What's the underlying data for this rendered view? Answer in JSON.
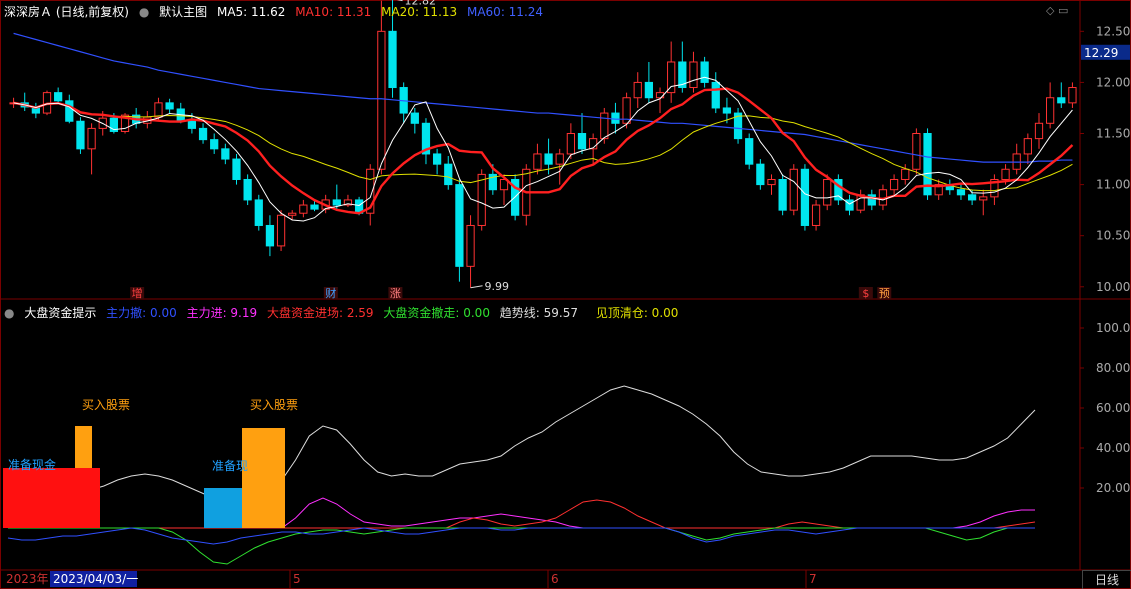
{
  "header": {
    "stock_name": "深深房Ａ (日线,前复权)",
    "main_chart_label": "默认主图",
    "ma5": "MA5: 11.62",
    "ma10": "MA10: 11.31",
    "ma20": "MA20: 11.13",
    "ma60": "MA60: 11.24"
  },
  "sub_header": {
    "indicator_name": "大盘资金提示",
    "main_out": "主力撤: 0.00",
    "main_in": "主力进: 9.19",
    "market_in": "大盘资金进场: 2.59",
    "market_out": "大盘资金撤走: 0.00",
    "trend": "趋势线: 59.57",
    "top_clear": "见顶清仓: 0.00"
  },
  "colors": {
    "up": "#ff3232",
    "down": "#00e5ee",
    "ma5": "#ffffff",
    "ma10": "#ff2020",
    "ma20": "#e0e000",
    "ma60": "#3050ff",
    "grid": "#7a0000",
    "ma10_text": "#ff3030",
    "ma20_text": "#e0e000",
    "ma60_text": "#4060ff",
    "price_tag_bg": "#0a2a8a"
  },
  "price_axis": {
    "ticks": [
      "12.50",
      "12.00",
      "11.50",
      "11.00",
      "10.50",
      "10.00"
    ],
    "current": "12.29"
  },
  "indicator_axis": {
    "ticks": [
      "100.00",
      "80.00",
      "60.00",
      "40.00",
      "20.00"
    ]
  },
  "annotations": {
    "high": "12.82",
    "low": "9.99"
  },
  "event_markers": [
    {
      "label": "增",
      "color": "#ff4040"
    },
    {
      "label": "财",
      "color": "#40a0ff"
    },
    {
      "label": "涨",
      "color": "#ff8080"
    },
    {
      "label": "$",
      "color": "#ff4040"
    },
    {
      "label": "预",
      "color": "#ffa040"
    }
  ],
  "signals": {
    "buy_label": "买入股票",
    "prepare_cash": "准备现金",
    "prepare_partial": "准备现"
  },
  "bottom_axis": {
    "year_label": "2023年",
    "cursor_date": "2023/04/03/一",
    "months": [
      "5",
      "6",
      "7"
    ]
  },
  "period_button": "日线",
  "chart_data": [
    {
      "type": "candlestick",
      "title": "深深房Ａ (日线,前复权)",
      "ylim": [
        9.9,
        12.65
      ],
      "x_month_labels": [
        "5",
        "6",
        "7"
      ],
      "ohlc": [
        [
          11.8,
          11.85,
          11.75,
          11.8
        ],
        [
          11.8,
          11.9,
          11.72,
          11.76
        ],
        [
          11.76,
          11.8,
          11.65,
          11.7
        ],
        [
          11.7,
          11.92,
          11.68,
          11.9
        ],
        [
          11.9,
          11.95,
          11.8,
          11.82
        ],
        [
          11.82,
          11.88,
          11.6,
          11.62
        ],
        [
          11.62,
          11.66,
          11.3,
          11.35
        ],
        [
          11.35,
          11.6,
          11.1,
          11.55
        ],
        [
          11.55,
          11.72,
          11.48,
          11.65
        ],
        [
          11.65,
          11.7,
          11.5,
          11.52
        ],
        [
          11.52,
          11.7,
          11.5,
          11.68
        ],
        [
          11.68,
          11.75,
          11.55,
          11.6
        ],
        [
          11.6,
          11.72,
          11.55,
          11.66
        ],
        [
          11.66,
          11.85,
          11.62,
          11.8
        ],
        [
          11.8,
          11.84,
          11.7,
          11.74
        ],
        [
          11.74,
          11.8,
          11.6,
          11.62
        ],
        [
          11.62,
          11.7,
          11.5,
          11.55
        ],
        [
          11.55,
          11.6,
          11.4,
          11.44
        ],
        [
          11.44,
          11.5,
          11.3,
          11.35
        ],
        [
          11.35,
          11.4,
          11.2,
          11.25
        ],
        [
          11.25,
          11.3,
          11.0,
          11.05
        ],
        [
          11.05,
          11.1,
          10.8,
          10.85
        ],
        [
          10.85,
          10.9,
          10.55,
          10.6
        ],
        [
          10.6,
          10.7,
          10.3,
          10.4
        ],
        [
          10.4,
          10.75,
          10.35,
          10.7
        ],
        [
          10.7,
          10.75,
          10.65,
          10.72
        ],
        [
          10.72,
          10.85,
          10.68,
          10.8
        ],
        [
          10.8,
          10.85,
          10.74,
          10.76
        ],
        [
          10.76,
          10.9,
          10.72,
          10.85
        ],
        [
          10.85,
          11.0,
          10.75,
          10.8
        ],
        [
          10.8,
          10.9,
          10.78,
          10.85
        ],
        [
          10.85,
          10.88,
          10.7,
          10.72
        ],
        [
          10.72,
          11.2,
          10.6,
          11.15
        ],
        [
          11.15,
          12.8,
          11.1,
          12.5
        ],
        [
          12.5,
          12.82,
          11.85,
          11.95
        ],
        [
          11.95,
          12.0,
          11.6,
          11.7
        ],
        [
          11.7,
          11.75,
          11.5,
          11.6
        ],
        [
          11.6,
          11.65,
          11.2,
          11.3
        ],
        [
          11.3,
          11.35,
          11.1,
          11.2
        ],
        [
          11.2,
          11.28,
          10.95,
          11.0
        ],
        [
          11.0,
          11.05,
          10.05,
          10.2
        ],
        [
          10.2,
          10.7,
          9.99,
          10.6
        ],
        [
          10.6,
          11.15,
          10.55,
          11.1
        ],
        [
          11.1,
          11.2,
          10.9,
          10.95
        ],
        [
          10.95,
          11.1,
          10.8,
          11.05
        ],
        [
          11.05,
          11.1,
          10.65,
          10.7
        ],
        [
          10.7,
          11.2,
          10.6,
          11.15
        ],
        [
          11.15,
          11.4,
          11.1,
          11.3
        ],
        [
          11.3,
          11.45,
          11.1,
          11.2
        ],
        [
          11.2,
          11.35,
          11.0,
          11.3
        ],
        [
          11.3,
          11.6,
          11.25,
          11.5
        ],
        [
          11.5,
          11.7,
          11.3,
          11.35
        ],
        [
          11.35,
          11.5,
          11.2,
          11.45
        ],
        [
          11.45,
          11.75,
          11.4,
          11.7
        ],
        [
          11.7,
          11.8,
          11.5,
          11.6
        ],
        [
          11.6,
          11.9,
          11.55,
          11.85
        ],
        [
          11.85,
          12.1,
          11.75,
          12.0
        ],
        [
          12.0,
          12.2,
          11.8,
          11.85
        ],
        [
          11.85,
          11.95,
          11.7,
          11.9
        ],
        [
          11.9,
          12.4,
          11.8,
          12.2
        ],
        [
          12.2,
          12.4,
          11.9,
          11.95
        ],
        [
          11.95,
          12.3,
          11.9,
          12.2
        ],
        [
          12.2,
          12.25,
          11.95,
          12.0
        ],
        [
          12.0,
          12.1,
          11.7,
          11.75
        ],
        [
          11.75,
          11.85,
          11.6,
          11.7
        ],
        [
          11.7,
          11.75,
          11.4,
          11.45
        ],
        [
          11.45,
          11.5,
          11.15,
          11.2
        ],
        [
          11.2,
          11.25,
          10.95,
          11.0
        ],
        [
          11.0,
          11.1,
          10.9,
          11.05
        ],
        [
          11.05,
          11.1,
          10.7,
          10.75
        ],
        [
          10.75,
          11.2,
          10.7,
          11.15
        ],
        [
          11.15,
          11.2,
          10.55,
          10.6
        ],
        [
          10.6,
          10.85,
          10.55,
          10.8
        ],
        [
          10.8,
          11.1,
          10.75,
          11.05
        ],
        [
          11.05,
          11.1,
          10.8,
          10.85
        ],
        [
          10.85,
          10.9,
          10.7,
          10.75
        ],
        [
          10.75,
          10.95,
          10.72,
          10.9
        ],
        [
          10.9,
          10.95,
          10.75,
          10.8
        ],
        [
          10.8,
          11.0,
          10.75,
          10.95
        ],
        [
          10.95,
          11.1,
          10.9,
          11.05
        ],
        [
          11.05,
          11.2,
          11.0,
          11.15
        ],
        [
          11.15,
          11.55,
          11.1,
          11.5
        ],
        [
          11.5,
          11.55,
          10.85,
          10.9
        ],
        [
          10.9,
          11.05,
          10.85,
          11.0
        ],
        [
          11.0,
          11.05,
          10.9,
          10.95
        ],
        [
          10.95,
          11.0,
          10.85,
          10.9
        ],
        [
          10.9,
          10.95,
          10.8,
          10.85
        ],
        [
          10.85,
          10.95,
          10.7,
          10.88
        ],
        [
          10.88,
          11.1,
          10.8,
          11.05
        ],
        [
          11.05,
          11.2,
          11.0,
          11.15
        ],
        [
          11.15,
          11.4,
          11.1,
          11.3
        ],
        [
          11.3,
          11.5,
          11.2,
          11.45
        ],
        [
          11.45,
          11.7,
          11.35,
          11.6
        ],
        [
          11.6,
          12.0,
          11.55,
          11.85
        ],
        [
          11.85,
          12.0,
          11.75,
          11.8
        ],
        [
          11.8,
          12.0,
          11.75,
          11.95
        ]
      ],
      "ma60": [
        12.48,
        12.45,
        12.42,
        12.39,
        12.36,
        12.33,
        12.3,
        12.27,
        12.24,
        12.21,
        12.19,
        12.17,
        12.15,
        12.12,
        12.1,
        12.08,
        12.06,
        12.04,
        12.02,
        12.0,
        11.98,
        11.96,
        11.94,
        11.93,
        11.92,
        11.91,
        11.9,
        11.89,
        11.88,
        11.87,
        11.86,
        11.85,
        11.84,
        11.84,
        11.83,
        11.82,
        11.81,
        11.8,
        11.79,
        11.78,
        11.77,
        11.76,
        11.75,
        11.74,
        11.73,
        11.72,
        11.71,
        11.7,
        11.7,
        11.69,
        11.68,
        11.67,
        11.66,
        11.65,
        11.64,
        11.64,
        11.63,
        11.62,
        11.61,
        11.6,
        11.6,
        11.59,
        11.58,
        11.57,
        11.56,
        11.55,
        11.54,
        11.53,
        11.52,
        11.51,
        11.5,
        11.49,
        11.47,
        11.45,
        11.43,
        11.41,
        11.39,
        11.37,
        11.35,
        11.33,
        11.31,
        11.29,
        11.27,
        11.26,
        11.25,
        11.24,
        11.23,
        11.22,
        11.22,
        11.22,
        11.22,
        11.22,
        11.23,
        11.23,
        11.24,
        11.24
      ]
    },
    {
      "type": "line",
      "title": "大盘资金提示",
      "ylim": [
        -20,
        105
      ],
      "series": [
        {
          "name": "趋势线",
          "values": [
            24,
            22,
            20,
            18,
            16,
            17,
            19,
            21,
            24,
            26,
            27,
            26,
            24,
            21,
            18,
            15,
            14,
            15,
            17,
            20,
            24,
            34,
            46,
            51,
            49,
            42,
            34,
            28,
            26,
            27,
            26,
            26,
            29,
            32,
            33,
            34,
            36,
            41,
            45,
            48,
            53,
            57,
            61,
            65,
            69,
            71,
            69,
            67,
            64,
            61,
            57,
            52,
            46,
            38,
            32,
            28,
            27,
            26,
            26,
            27,
            28,
            30,
            33,
            36,
            36,
            36,
            36,
            35,
            34,
            34,
            35,
            38,
            41,
            45,
            52,
            59
          ]
        },
        {
          "name": "主力进",
          "values": [
            2,
            1,
            0,
            0,
            0,
            0,
            0,
            0,
            0,
            0,
            0,
            0,
            0,
            0,
            0,
            0,
            0,
            0,
            0,
            0,
            0,
            5,
            12,
            15,
            12,
            7,
            3,
            2,
            1,
            1,
            2,
            3,
            4,
            5,
            5,
            6,
            7,
            6,
            5,
            4,
            3,
            1,
            0,
            0,
            0,
            0,
            0,
            0,
            0,
            0,
            0,
            0,
            0,
            0,
            0,
            0,
            0,
            0,
            0,
            0,
            0,
            0,
            0,
            0,
            0,
            0,
            0,
            0,
            0,
            0,
            1,
            3,
            6,
            8,
            9,
            9
          ]
        },
        {
          "name": "大盘资金进场",
          "values": [
            0,
            0,
            2,
            4,
            3,
            1,
            0,
            0,
            0,
            0,
            0,
            0,
            0,
            0,
            0,
            0,
            0,
            0,
            0,
            0,
            0,
            0,
            0,
            0,
            0,
            0,
            0,
            0,
            0,
            0,
            0,
            0,
            0,
            3,
            5,
            4,
            2,
            1,
            2,
            3,
            5,
            9,
            13,
            14,
            13,
            10,
            6,
            3,
            0,
            0,
            0,
            0,
            0,
            0,
            0,
            0,
            0,
            2,
            3,
            2,
            1,
            0,
            0,
            0,
            0,
            0,
            0,
            0,
            0,
            0,
            0,
            0,
            0,
            1,
            2,
            3
          ]
        },
        {
          "name": "大盘资金撤走",
          "values": [
            0,
            0,
            0,
            0,
            0,
            0,
            0,
            0,
            0,
            0,
            0,
            0,
            -2,
            -6,
            -12,
            -17,
            -18,
            -14,
            -10,
            -7,
            -5,
            -3,
            -2,
            -1,
            -1,
            -2,
            -3,
            -2,
            -1,
            0,
            0,
            0,
            0,
            0,
            0,
            0,
            0,
            0,
            0,
            0,
            0,
            0,
            0,
            0,
            0,
            0,
            0,
            0,
            0,
            -2,
            -4,
            -6,
            -5,
            -3,
            -2,
            -1,
            0,
            0,
            0,
            0,
            0,
            0,
            0,
            0,
            0,
            0,
            0,
            0,
            -2,
            -4,
            -6,
            -5,
            -2,
            0,
            0,
            0
          ]
        },
        {
          "name": "主力撤",
          "values": [
            -5,
            -6,
            -6,
            -5,
            -4,
            -4,
            -3,
            -2,
            -1,
            0,
            -1,
            -3,
            -5,
            -6,
            -7,
            -8,
            -7,
            -5,
            -4,
            -3,
            -2,
            -2,
            -3,
            -3,
            -2,
            -1,
            0,
            -1,
            -2,
            -3,
            -3,
            -2,
            -1,
            0,
            0,
            0,
            -1,
            -1,
            0,
            0,
            0,
            0,
            0,
            0,
            0,
            0,
            0,
            0,
            0,
            -2,
            -5,
            -7,
            -6,
            -4,
            -3,
            -2,
            -1,
            -1,
            -2,
            -3,
            -2,
            -1,
            0,
            0,
            0,
            0,
            0,
            0,
            0,
            0,
            0,
            0,
            0,
            0,
            0,
            0
          ]
        }
      ],
      "bars": [
        {
          "label": "准备现金",
          "from": 0,
          "to": 30,
          "color": "#ff1010"
        },
        {
          "label": "买入股票",
          "from": 30,
          "to": 51,
          "color": "#ffa010"
        },
        {
          "label": "准备现",
          "from": 0,
          "to": 20,
          "color": "#10a0e0"
        },
        {
          "label": "买入股票",
          "from": 0,
          "to": 50,
          "color": "#ffa010"
        }
      ]
    }
  ]
}
